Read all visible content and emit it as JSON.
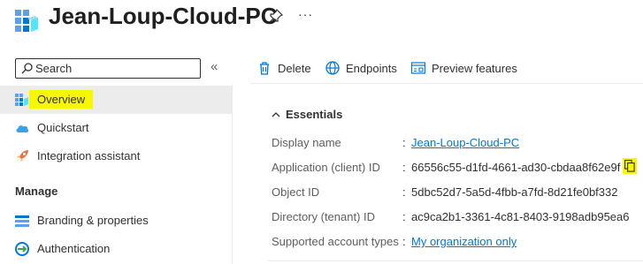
{
  "header": {
    "title": "Jean-Loup-Cloud-PC",
    "more_label": "···"
  },
  "sidebar": {
    "search": {
      "placeholder": "Search",
      "value": ""
    },
    "collapse_label": "«",
    "items": [
      {
        "label": "Overview",
        "icon": "overview-grid-icon",
        "selected": true
      },
      {
        "label": "Quickstart",
        "icon": "cloud-icon"
      },
      {
        "label": "Integration assistant",
        "icon": "rocket-icon"
      }
    ],
    "section": "Manage",
    "manage_items": [
      {
        "label": "Branding & properties",
        "icon": "branding-icon"
      },
      {
        "label": "Authentication",
        "icon": "authentication-icon"
      }
    ]
  },
  "toolbar": {
    "delete_label": "Delete",
    "endpoints_label": "Endpoints",
    "preview_label": "Preview features"
  },
  "essentials": {
    "title": "Essentials",
    "rows": [
      {
        "key": "Display name",
        "value": "Jean-Loup-Cloud-PC",
        "link": true
      },
      {
        "key": "Application (client) ID",
        "value": "66556c55-d1fd-4661-ad30-cbdaa8f62e9f"
      },
      {
        "key": "Object ID",
        "value": "5dbc52d7-5a5d-4fbb-a7fd-8d21fe0bf332"
      },
      {
        "key": "Directory (tenant) ID",
        "value": "ac9ca2b1-3361-4c81-8403-9198adb95ea6"
      },
      {
        "key": "Supported account types",
        "value": "My organization only",
        "link": true
      }
    ],
    "separator": ":"
  },
  "colors": {
    "accent": "#0078d4",
    "highlight": "#f7f700",
    "selected_bg": "#ececec"
  }
}
